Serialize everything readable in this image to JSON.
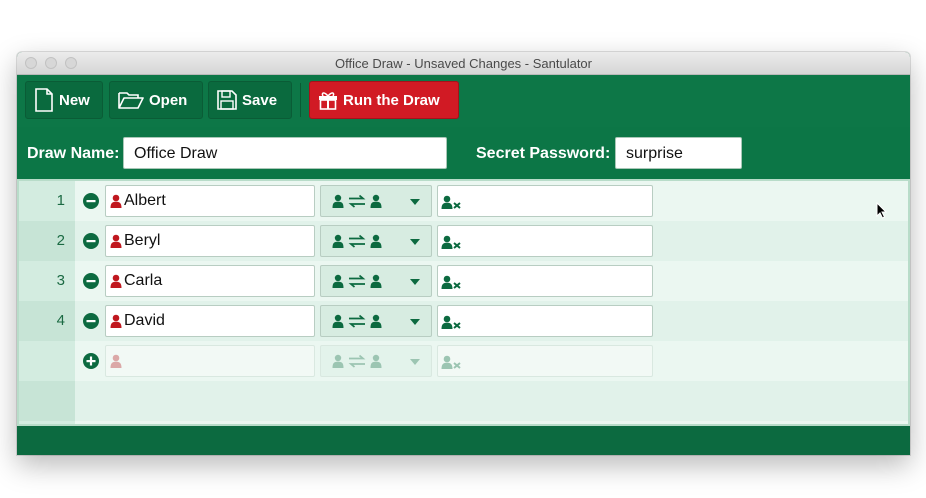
{
  "window": {
    "title": "Office Draw - Unsaved Changes - Santulator"
  },
  "toolbar": {
    "new_label": "New",
    "open_label": "Open",
    "save_label": "Save",
    "run_label": "Run the Draw"
  },
  "draw": {
    "name_label": "Draw Name:",
    "name_value": "Office Draw",
    "password_label": "Secret Password:",
    "password_value": "surprise"
  },
  "participants": [
    {
      "number": "1",
      "name": "Albert"
    },
    {
      "number": "2",
      "name": "Beryl"
    },
    {
      "number": "3",
      "name": "Carla"
    },
    {
      "number": "4",
      "name": "David"
    }
  ],
  "colors": {
    "brand_green": "#0c7646",
    "run_red": "#d11a24",
    "person_red": "#c0181f"
  },
  "icons": {
    "new": "document-icon",
    "open": "folder-open-icon",
    "save": "floppy-disk-icon",
    "run": "gift-icon",
    "remove": "minus-circle-icon",
    "add": "plus-circle-icon",
    "person": "person-icon",
    "swap": "users-swap-icon",
    "exclusions": "user-exclude-icon"
  }
}
